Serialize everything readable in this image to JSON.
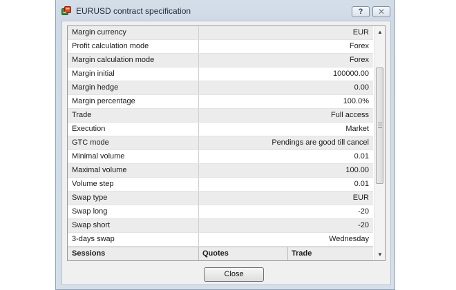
{
  "window": {
    "title": "EURUSD contract specification",
    "help_label": "?",
    "close_glyph": "✕",
    "icon": "app-icon"
  },
  "spec_rows": [
    {
      "name": "Margin currency",
      "value": "EUR"
    },
    {
      "name": "Profit calculation mode",
      "value": "Forex"
    },
    {
      "name": "Margin calculation mode",
      "value": "Forex"
    },
    {
      "name": "Margin initial",
      "value": "100000.00"
    },
    {
      "name": "Margin hedge",
      "value": "0.00"
    },
    {
      "name": "Margin percentage",
      "value": "100.0%"
    },
    {
      "name": "Trade",
      "value": "Full access"
    },
    {
      "name": "Execution",
      "value": "Market"
    },
    {
      "name": "GTC mode",
      "value": "Pendings are good till cancel"
    },
    {
      "name": "Minimal volume",
      "value": "0.01"
    },
    {
      "name": "Maximal volume",
      "value": "100.00"
    },
    {
      "name": "Volume step",
      "value": "0.01"
    },
    {
      "name": "Swap type",
      "value": "EUR"
    },
    {
      "name": "Swap long",
      "value": "-20"
    },
    {
      "name": "Swap short",
      "value": "-20"
    },
    {
      "name": "3-days swap",
      "value": "Wednesday"
    }
  ],
  "sessions_header": {
    "sessions": "Sessions",
    "quotes": "Quotes",
    "trade": "Trade"
  },
  "scrollbar": {
    "up_glyph": "▲",
    "down_glyph": "▼"
  },
  "footer": {
    "close_label": "Close"
  },
  "colors": {
    "row_odd": "#ececec",
    "row_even": "#ffffff",
    "title_text": "#1e2b3a"
  }
}
